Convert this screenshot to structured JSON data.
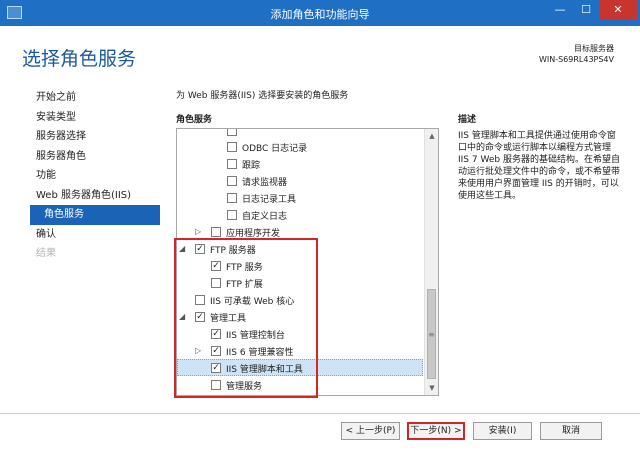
{
  "window": {
    "title": "添加角色和功能向导",
    "min": "—",
    "max": "☐",
    "close": "✕"
  },
  "header": {
    "page_title": "选择角色服务",
    "server_label": "目标服务器",
    "server_name": "WIN-S69RL43PS4V"
  },
  "nav": {
    "items": [
      {
        "label": "开始之前"
      },
      {
        "label": "安装类型"
      },
      {
        "label": "服务器选择"
      },
      {
        "label": "服务器角色"
      },
      {
        "label": "功能"
      },
      {
        "label": "Web 服务器角色(IIS)"
      },
      {
        "label": "角色服务"
      },
      {
        "label": "确认"
      },
      {
        "label": "结果"
      }
    ]
  },
  "main": {
    "description_line": "为 Web 服务器(IIS) 选择要安装的角色服务",
    "column_header": "角色服务",
    "tree": [
      {
        "label": "",
        "checked": false
      },
      {
        "label": "ODBC 日志记录",
        "checked": false
      },
      {
        "label": "跟踪",
        "checked": false
      },
      {
        "label": "请求监视器",
        "checked": false
      },
      {
        "label": "日志记录工具",
        "checked": false
      },
      {
        "label": "自定义日志",
        "checked": false
      },
      {
        "label": "应用程序开发",
        "checked": false,
        "expander": "▷"
      },
      {
        "label": "FTP 服务器",
        "checked": true,
        "expander": "◢"
      },
      {
        "label": "FTP 服务",
        "checked": true
      },
      {
        "label": "FTP 扩展",
        "checked": false
      },
      {
        "label": "IIS 可承载 Web 核心",
        "checked": false
      },
      {
        "label": "管理工具",
        "checked": true,
        "expander": "◢"
      },
      {
        "label": "IIS 管理控制台",
        "checked": true
      },
      {
        "label": "IIS 6 管理兼容性",
        "checked": true,
        "expander": "▷"
      },
      {
        "label": "IIS 管理脚本和工具",
        "checked": true,
        "selected": true
      },
      {
        "label": "管理服务",
        "checked": false
      }
    ]
  },
  "description": {
    "title": "描述",
    "text": "IIS 管理脚本和工具提供通过使用命令窗口中的命令或运行脚本以编程方式管理 IIS 7 Web 服务器的基础结构。在希望自动运行批处理文件中的命令，或不希望带来使用用户界面管理 IIS 的开销时，可以使用这些工具。"
  },
  "buttons": {
    "prev": "< 上一步(P)",
    "next": "下一步(N) >",
    "install": "安装(I)",
    "cancel": "取消"
  },
  "colors": {
    "titlebar": "#1f6fc4",
    "accent": "#1a63b6",
    "highlight": "#d02727"
  }
}
